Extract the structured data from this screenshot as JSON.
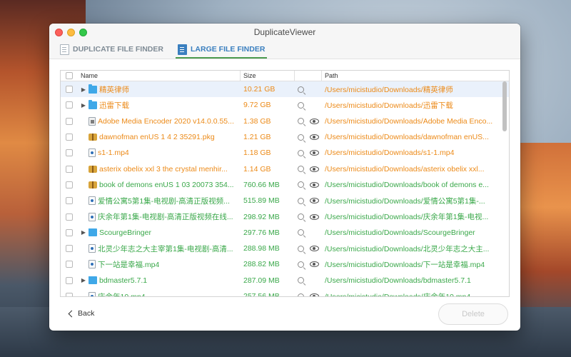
{
  "window": {
    "title": "DuplicateViewer"
  },
  "tabs": [
    {
      "label": "DUPLICATE FILE FINDER",
      "active": false,
      "icon": "document-icon"
    },
    {
      "label": "LARGE FILE FINDER",
      "active": true,
      "icon": "large-file-icon"
    }
  ],
  "table": {
    "columns": {
      "name": "Name",
      "size": "Size",
      "path": "Path"
    },
    "rows": [
      {
        "type": "folder",
        "name": "精英律师",
        "size": "10.21 GB",
        "path": "/Users/micistudio/Downloads/精英律师",
        "color": "orange",
        "expandable": true,
        "preview": false,
        "selected": true
      },
      {
        "type": "folder",
        "name": "迅雷下载",
        "size": "9.72 GB",
        "path": "/Users/micistudio/Downloads/迅雷下载",
        "color": "orange",
        "expandable": true,
        "preview": false,
        "selected": false
      },
      {
        "type": "app",
        "name": "Adobe Media Encoder 2020 v14.0.0.55...",
        "size": "1.38 GB",
        "path": "/Users/micistudio/Downloads/Adobe Media Enco...",
        "color": "orange",
        "expandable": false,
        "preview": true,
        "selected": false
      },
      {
        "type": "pkg",
        "name": "dawnofman enUS 1 4 2 35291.pkg",
        "size": "1.21 GB",
        "path": "/Users/micistudio/Downloads/dawnofman enUS...",
        "color": "orange",
        "expandable": false,
        "preview": true,
        "selected": false
      },
      {
        "type": "video",
        "name": "s1-1.mp4",
        "size": "1.18 GB",
        "path": "/Users/micistudio/Downloads/s1-1.mp4",
        "color": "orange",
        "expandable": false,
        "preview": true,
        "selected": false
      },
      {
        "type": "pkg",
        "name": "asterix   obelix xxl 3   the crystal menhir...",
        "size": "1.14 GB",
        "path": "/Users/micistudio/Downloads/asterix   obelix xxl...",
        "color": "orange",
        "expandable": false,
        "preview": true,
        "selected": false
      },
      {
        "type": "pkg",
        "name": "book of demons enUS 1 03 20073 354...",
        "size": "760.66 MB",
        "path": "/Users/micistudio/Downloads/book of demons e...",
        "color": "green",
        "expandable": false,
        "preview": true,
        "selected": false
      },
      {
        "type": "video",
        "name": "爱情公寓5第1集-电视剧-高清正版视频...",
        "size": "515.89 MB",
        "path": "/Users/micistudio/Downloads/爱情公寓5第1集-...",
        "color": "green",
        "expandable": false,
        "preview": true,
        "selected": false
      },
      {
        "type": "video",
        "name": "庆余年第1集-电视剧-高清正版视频在线...",
        "size": "298.92 MB",
        "path": "/Users/micistudio/Downloads/庆余年第1集-电视...",
        "color": "green",
        "expandable": false,
        "preview": true,
        "selected": false
      },
      {
        "type": "folder",
        "name": "ScourgeBringer",
        "size": "297.76 MB",
        "path": "/Users/micistudio/Downloads/ScourgeBringer",
        "color": "green",
        "expandable": true,
        "preview": false,
        "selected": false
      },
      {
        "type": "video",
        "name": "北灵少年志之大主宰第1集-电视剧-高清...",
        "size": "288.98 MB",
        "path": "/Users/micistudio/Downloads/北灵少年志之大主...",
        "color": "green",
        "expandable": false,
        "preview": true,
        "selected": false
      },
      {
        "type": "video",
        "name": "下一站是幸福.mp4",
        "size": "288.82 MB",
        "path": "/Users/micistudio/Downloads/下一站是幸福.mp4",
        "color": "green",
        "expandable": false,
        "preview": true,
        "selected": false
      },
      {
        "type": "folder",
        "name": "bdmaster5.7.1",
        "size": "287.09 MB",
        "path": "/Users/micistudio/Downloads/bdmaster5.7.1",
        "color": "green",
        "expandable": true,
        "preview": false,
        "selected": false
      },
      {
        "type": "video",
        "name": "庆余年10.mp4",
        "size": "257.56 MB",
        "path": "/Users/micistudio/Downloads/庆余年10.mp4",
        "color": "green",
        "expandable": false,
        "preview": true,
        "selected": false
      }
    ]
  },
  "footer": {
    "back_label": "Back",
    "delete_label": "Delete",
    "delete_enabled": false
  },
  "colors": {
    "orange": "#ec8a18",
    "green": "#3aa84a",
    "accent": "#3a7fbf"
  }
}
